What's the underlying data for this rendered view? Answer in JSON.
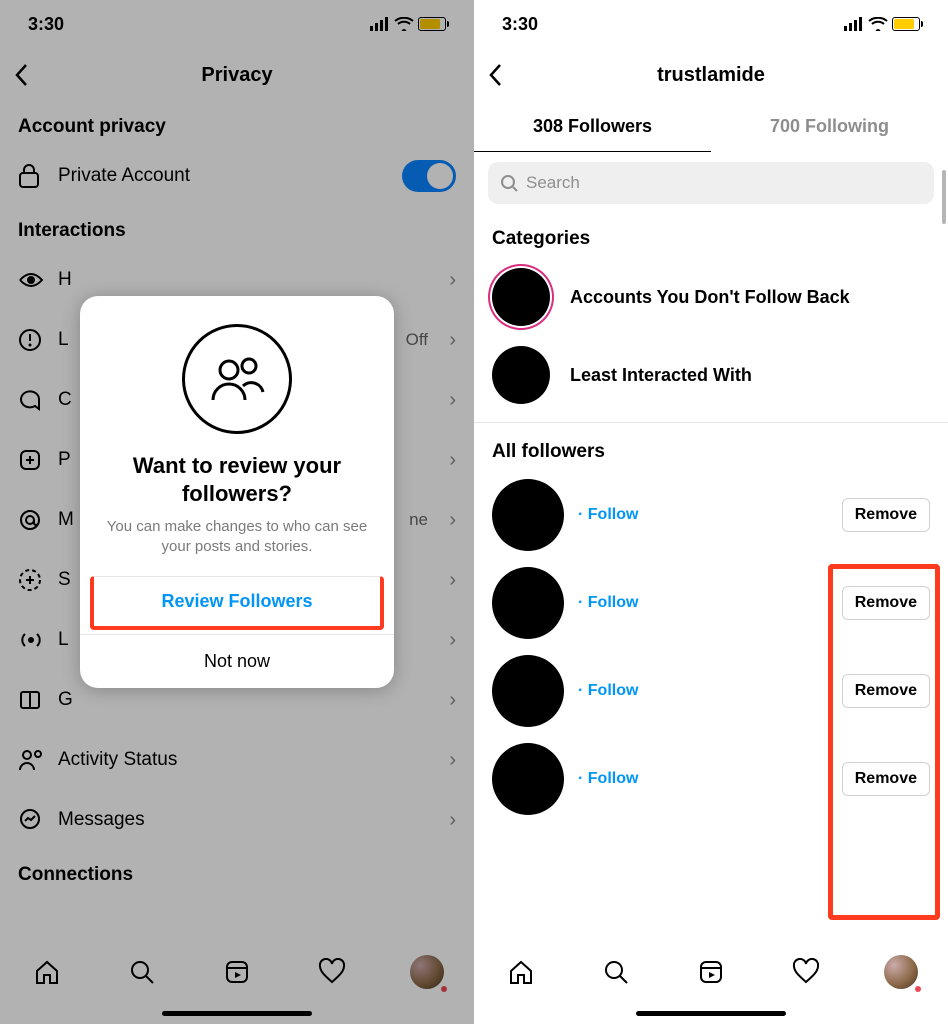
{
  "status": {
    "time": "3:30"
  },
  "left": {
    "title": "Privacy",
    "sections": {
      "account_privacy": "Account privacy",
      "interactions": "Interactions",
      "connections": "Connections"
    },
    "rows": {
      "private_account": "Private Account",
      "h": "H",
      "l": "L",
      "l_trail": "Off",
      "c": "C",
      "p": "P",
      "m": "M",
      "m_trail": "ne",
      "s": "S",
      "li": "L",
      "g": "G",
      "activity_status": "Activity Status",
      "messages": "Messages"
    },
    "modal": {
      "title": "Want to review your followers?",
      "body": "You can make changes to who can see your posts and stories.",
      "primary": "Review Followers",
      "secondary": "Not now"
    }
  },
  "right": {
    "username": "trustlamide",
    "tabs": {
      "followers": "308 Followers",
      "following": "700 Following"
    },
    "search_placeholder": "Search",
    "categories_label": "Categories",
    "categories": [
      {
        "label": "Accounts You Don't Follow Back"
      },
      {
        "label": "Least Interacted With"
      }
    ],
    "all_followers_label": "All followers",
    "follow_label": "Follow",
    "remove_label": "Remove"
  }
}
